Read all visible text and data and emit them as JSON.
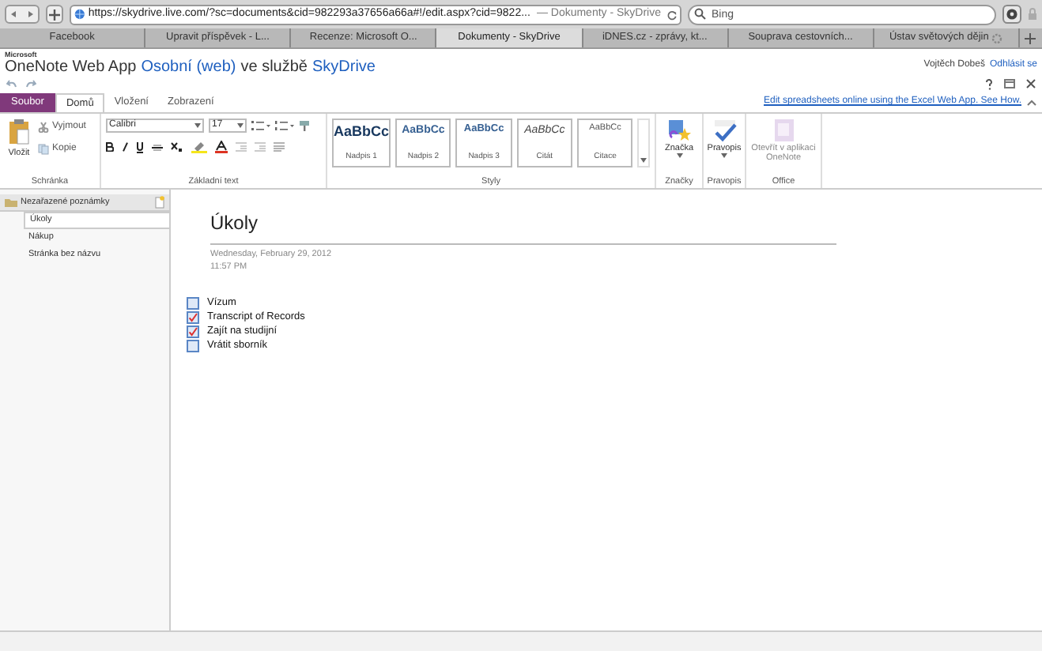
{
  "browser": {
    "url": "https://skydrive.live.com/?sc=documents&cid=982293a37656a66a#!/edit.aspx?cid=9822...",
    "page_title": "— Dokumenty - SkyDrive",
    "search": {
      "placeholder": "Bing"
    }
  },
  "tabs": [
    {
      "label": "Facebook",
      "selected": false,
      "loading": false
    },
    {
      "label": "Upravit příspěvek - L...",
      "selected": false,
      "loading": false
    },
    {
      "label": "Recenze: Microsoft O...",
      "selected": false,
      "loading": false
    },
    {
      "label": "Dokumenty - SkyDrive",
      "selected": true,
      "loading": false
    },
    {
      "label": "iDNES.cz - zprávy, kt...",
      "selected": false,
      "loading": false
    },
    {
      "label": "Souprava cestovních...",
      "selected": false,
      "loading": false
    },
    {
      "label": "Ústav světových dějin",
      "selected": false,
      "loading": true
    }
  ],
  "app": {
    "maker": "Microsoft",
    "product": "OneNote Web App",
    "notebook_link": "Osobní (web)",
    "connector": "ve službě",
    "service_link": "SkyDrive",
    "user": "Vojtěch Dobeš",
    "sign_out": "Odhlásit se"
  },
  "ribbon_tabs": [
    {
      "label": "Soubor",
      "kind": "file",
      "selected": false
    },
    {
      "label": "Domů",
      "kind": "tab",
      "selected": true
    },
    {
      "label": "Vložení",
      "kind": "tab",
      "selected": false
    },
    {
      "label": "Zobrazení",
      "kind": "tab",
      "selected": false
    }
  ],
  "promo_link": "Edit spreadsheets online using the Excel Web App. See How.",
  "ribbon": {
    "clipboard": {
      "paste": "Vložit",
      "cut": "Vyjmout",
      "copy": "Kopie",
      "label": "Schránka"
    },
    "basic_text": {
      "font": "Calibri",
      "size": "17",
      "label": "Základní text"
    },
    "styles": {
      "label": "Styly",
      "items": [
        {
          "kind": "h1",
          "preview": "AaBbCc",
          "name": "Nadpis 1"
        },
        {
          "kind": "h2",
          "preview": "AaBbCc",
          "name": "Nadpis 2"
        },
        {
          "kind": "h3",
          "preview": "AaBbCc",
          "name": "Nadpis 3"
        },
        {
          "kind": "quote",
          "preview": "AaBbCc",
          "name": "Citát"
        },
        {
          "kind": "citation",
          "preview": "AaBbCc",
          "name": "Citace"
        }
      ]
    },
    "tags": {
      "button": "Značka",
      "label": "Značky"
    },
    "spelling": {
      "button": "Pravopis",
      "label": "Pravopis"
    },
    "office": {
      "button": "Otevřít v aplikaci OneNote",
      "disabled": true,
      "label": "Office"
    }
  },
  "sidebar": {
    "section": "Nezařazené poznámky",
    "pages": [
      {
        "label": "Úkoly",
        "selected": true
      },
      {
        "label": "Nákup",
        "selected": false
      },
      {
        "label": "Stránka bez názvu",
        "selected": false
      }
    ]
  },
  "page": {
    "title": "Úkoly",
    "date": "Wednesday, February 29, 2012",
    "time": "11:57 PM",
    "todos": [
      {
        "text": "Vízum",
        "checked": false
      },
      {
        "text": "Transcript of Records",
        "checked": true
      },
      {
        "text": "Zajít na studijní",
        "checked": true
      },
      {
        "text": "Vrátit sborník",
        "checked": false
      }
    ]
  }
}
